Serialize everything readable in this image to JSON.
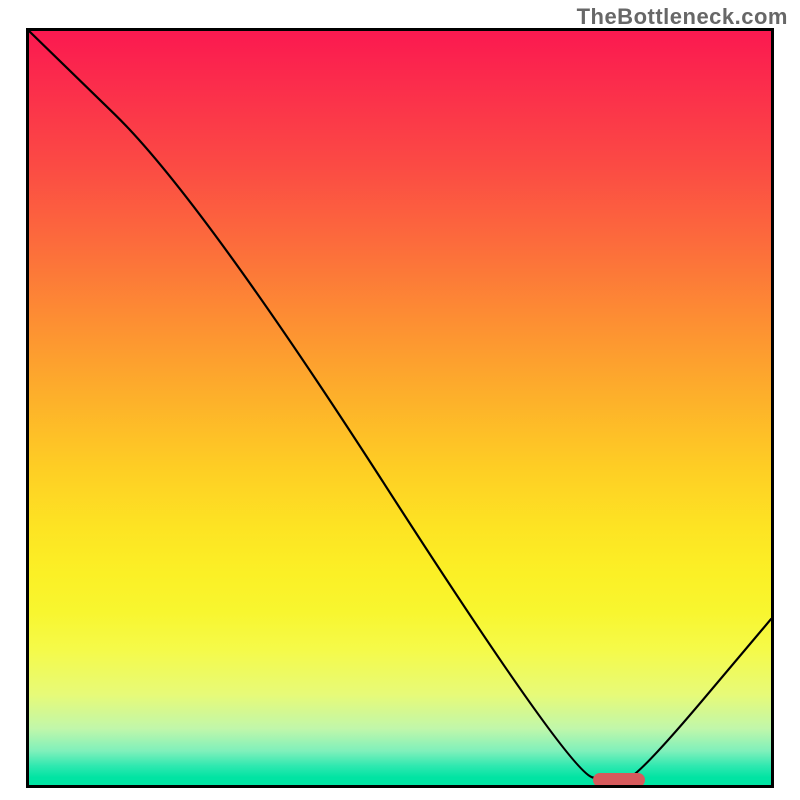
{
  "watermark": "TheBottleneck.com",
  "chart_data": {
    "type": "line",
    "title": "",
    "xlabel": "",
    "ylabel": "",
    "xlim": [
      0,
      100
    ],
    "ylim": [
      0,
      100
    ],
    "grid": false,
    "legend": false,
    "series": [
      {
        "name": "bottleneck-curve",
        "x": [
          0,
          23,
          73,
          79,
          82,
          100
        ],
        "y": [
          100,
          78,
          1.5,
          0.5,
          1,
          22
        ],
        "color": "#000000",
        "stroke_width": 2.2
      }
    ],
    "marker": {
      "name": "optimal-range",
      "x_start": 76,
      "x_end": 83,
      "y": 0.6,
      "color": "#d65a5c"
    },
    "background_gradient": {
      "top": "#fb1950",
      "middle": "#fde423",
      "bottom": "#01e4a3"
    }
  },
  "layout": {
    "plot_inner_w": 742,
    "plot_inner_h": 754
  }
}
